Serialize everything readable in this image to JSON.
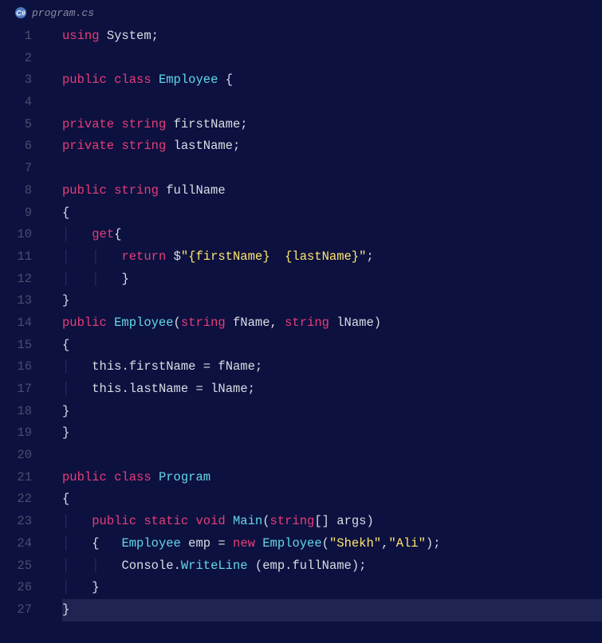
{
  "tab": {
    "filename": "program.cs",
    "icon": "csharp-icon"
  },
  "lines": [
    {
      "n": 1,
      "indent": 0,
      "tokens": [
        [
          "kw",
          "using"
        ],
        [
          "s",
          " "
        ],
        [
          "ident",
          "System"
        ],
        [
          "punct",
          ";"
        ]
      ]
    },
    {
      "n": 2,
      "indent": 0,
      "tokens": []
    },
    {
      "n": 3,
      "indent": 0,
      "tokens": [
        [
          "kw",
          "public"
        ],
        [
          "s",
          " "
        ],
        [
          "kw",
          "class"
        ],
        [
          "s",
          " "
        ],
        [
          "cls",
          "Employee"
        ],
        [
          "s",
          " "
        ],
        [
          "punct",
          "{"
        ]
      ]
    },
    {
      "n": 4,
      "indent": 0,
      "tokens": []
    },
    {
      "n": 5,
      "indent": 0,
      "tokens": [
        [
          "kw",
          "private"
        ],
        [
          "s",
          " "
        ],
        [
          "type",
          "string"
        ],
        [
          "s",
          " "
        ],
        [
          "ident",
          "firstName"
        ],
        [
          "punct",
          ";"
        ]
      ]
    },
    {
      "n": 6,
      "indent": 0,
      "tokens": [
        [
          "kw",
          "private"
        ],
        [
          "s",
          " "
        ],
        [
          "type",
          "string"
        ],
        [
          "s",
          " "
        ],
        [
          "ident",
          "lastName"
        ],
        [
          "punct",
          ";"
        ]
      ]
    },
    {
      "n": 7,
      "indent": 0,
      "tokens": []
    },
    {
      "n": 8,
      "indent": 0,
      "tokens": [
        [
          "kw",
          "public"
        ],
        [
          "s",
          " "
        ],
        [
          "type",
          "string"
        ],
        [
          "s",
          " "
        ],
        [
          "ident",
          "fullName"
        ]
      ]
    },
    {
      "n": 9,
      "indent": 0,
      "tokens": [
        [
          "punct",
          "{"
        ]
      ]
    },
    {
      "n": 10,
      "indent": 1,
      "tokens": [
        [
          "kw",
          "get"
        ],
        [
          "punct",
          "{"
        ]
      ]
    },
    {
      "n": 11,
      "indent": 2,
      "tokens": [
        [
          "kw",
          "return"
        ],
        [
          "s",
          " "
        ],
        [
          "punct",
          "$"
        ],
        [
          "str",
          "\"{firstName}  {lastName}\""
        ],
        [
          "punct",
          ";"
        ]
      ]
    },
    {
      "n": 12,
      "indent": 2,
      "tokens": [
        [
          "punct",
          "}"
        ]
      ]
    },
    {
      "n": 13,
      "indent": 0,
      "tokens": [
        [
          "punct",
          "}"
        ]
      ]
    },
    {
      "n": 14,
      "indent": 0,
      "tokens": [
        [
          "kw",
          "public"
        ],
        [
          "s",
          " "
        ],
        [
          "cls",
          "Employee"
        ],
        [
          "punct",
          "("
        ],
        [
          "type",
          "string"
        ],
        [
          "s",
          " "
        ],
        [
          "ident",
          "fName"
        ],
        [
          "punct",
          ","
        ],
        [
          "s",
          " "
        ],
        [
          "type",
          "string"
        ],
        [
          "s",
          " "
        ],
        [
          "ident",
          "lName"
        ],
        [
          "punct",
          ")"
        ]
      ]
    },
    {
      "n": 15,
      "indent": 0,
      "tokens": [
        [
          "punct",
          "{"
        ]
      ]
    },
    {
      "n": 16,
      "indent": 1,
      "tokens": [
        [
          "this",
          "this"
        ],
        [
          "punct",
          "."
        ],
        [
          "prop",
          "firstName"
        ],
        [
          "s",
          " "
        ],
        [
          "punct",
          "="
        ],
        [
          "s",
          " "
        ],
        [
          "ident",
          "fName"
        ],
        [
          "punct",
          ";"
        ]
      ]
    },
    {
      "n": 17,
      "indent": 1,
      "tokens": [
        [
          "this",
          "this"
        ],
        [
          "punct",
          "."
        ],
        [
          "prop",
          "lastName"
        ],
        [
          "s",
          " "
        ],
        [
          "punct",
          "="
        ],
        [
          "s",
          " "
        ],
        [
          "ident",
          "lName"
        ],
        [
          "punct",
          ";"
        ]
      ]
    },
    {
      "n": 18,
      "indent": 0,
      "tokens": [
        [
          "punct",
          "}"
        ]
      ]
    },
    {
      "n": 19,
      "indent": 0,
      "tokens": [
        [
          "punct",
          "}"
        ]
      ]
    },
    {
      "n": 20,
      "indent": 0,
      "tokens": []
    },
    {
      "n": 21,
      "indent": 0,
      "tokens": [
        [
          "kw",
          "public"
        ],
        [
          "s",
          " "
        ],
        [
          "kw",
          "class"
        ],
        [
          "s",
          " "
        ],
        [
          "cls",
          "Program"
        ]
      ]
    },
    {
      "n": 22,
      "indent": 0,
      "tokens": [
        [
          "punct",
          "{"
        ]
      ]
    },
    {
      "n": 23,
      "indent": 1,
      "tokens": [
        [
          "kw",
          "public"
        ],
        [
          "s",
          " "
        ],
        [
          "kw",
          "static"
        ],
        [
          "s",
          " "
        ],
        [
          "kw",
          "void"
        ],
        [
          "s",
          " "
        ],
        [
          "method",
          "Main"
        ],
        [
          "punct",
          "("
        ],
        [
          "type",
          "string"
        ],
        [
          "punct",
          "[]"
        ],
        [
          "s",
          " "
        ],
        [
          "ident",
          "args"
        ],
        [
          "punct",
          ")"
        ]
      ]
    },
    {
      "n": 24,
      "indent": 1,
      "tokens": [
        [
          "punct",
          "{"
        ],
        [
          "s",
          "   "
        ],
        [
          "cls",
          "Employee"
        ],
        [
          "s",
          " "
        ],
        [
          "ident",
          "emp"
        ],
        [
          "s",
          " "
        ],
        [
          "punct",
          "="
        ],
        [
          "s",
          " "
        ],
        [
          "new",
          "new"
        ],
        [
          "s",
          " "
        ],
        [
          "cls",
          "Employee"
        ],
        [
          "punct",
          "("
        ],
        [
          "str",
          "\"Shekh\""
        ],
        [
          "punct",
          ","
        ],
        [
          "str",
          "\"Ali\""
        ],
        [
          "punct",
          ")"
        ],
        [
          "punct",
          ";"
        ]
      ]
    },
    {
      "n": 25,
      "indent": 2,
      "tokens": [
        [
          "ident",
          "Console"
        ],
        [
          "punct",
          "."
        ],
        [
          "method",
          "WriteLine"
        ],
        [
          "s",
          " "
        ],
        [
          "punct",
          "("
        ],
        [
          "ident",
          "emp"
        ],
        [
          "punct",
          "."
        ],
        [
          "prop",
          "fullName"
        ],
        [
          "punct",
          ")"
        ],
        [
          "punct",
          ";"
        ]
      ]
    },
    {
      "n": 26,
      "indent": 1,
      "tokens": [
        [
          "punct",
          "}"
        ]
      ]
    },
    {
      "n": 27,
      "indent": 0,
      "current": true,
      "tokens": [
        [
          "punct",
          "}"
        ]
      ]
    }
  ]
}
